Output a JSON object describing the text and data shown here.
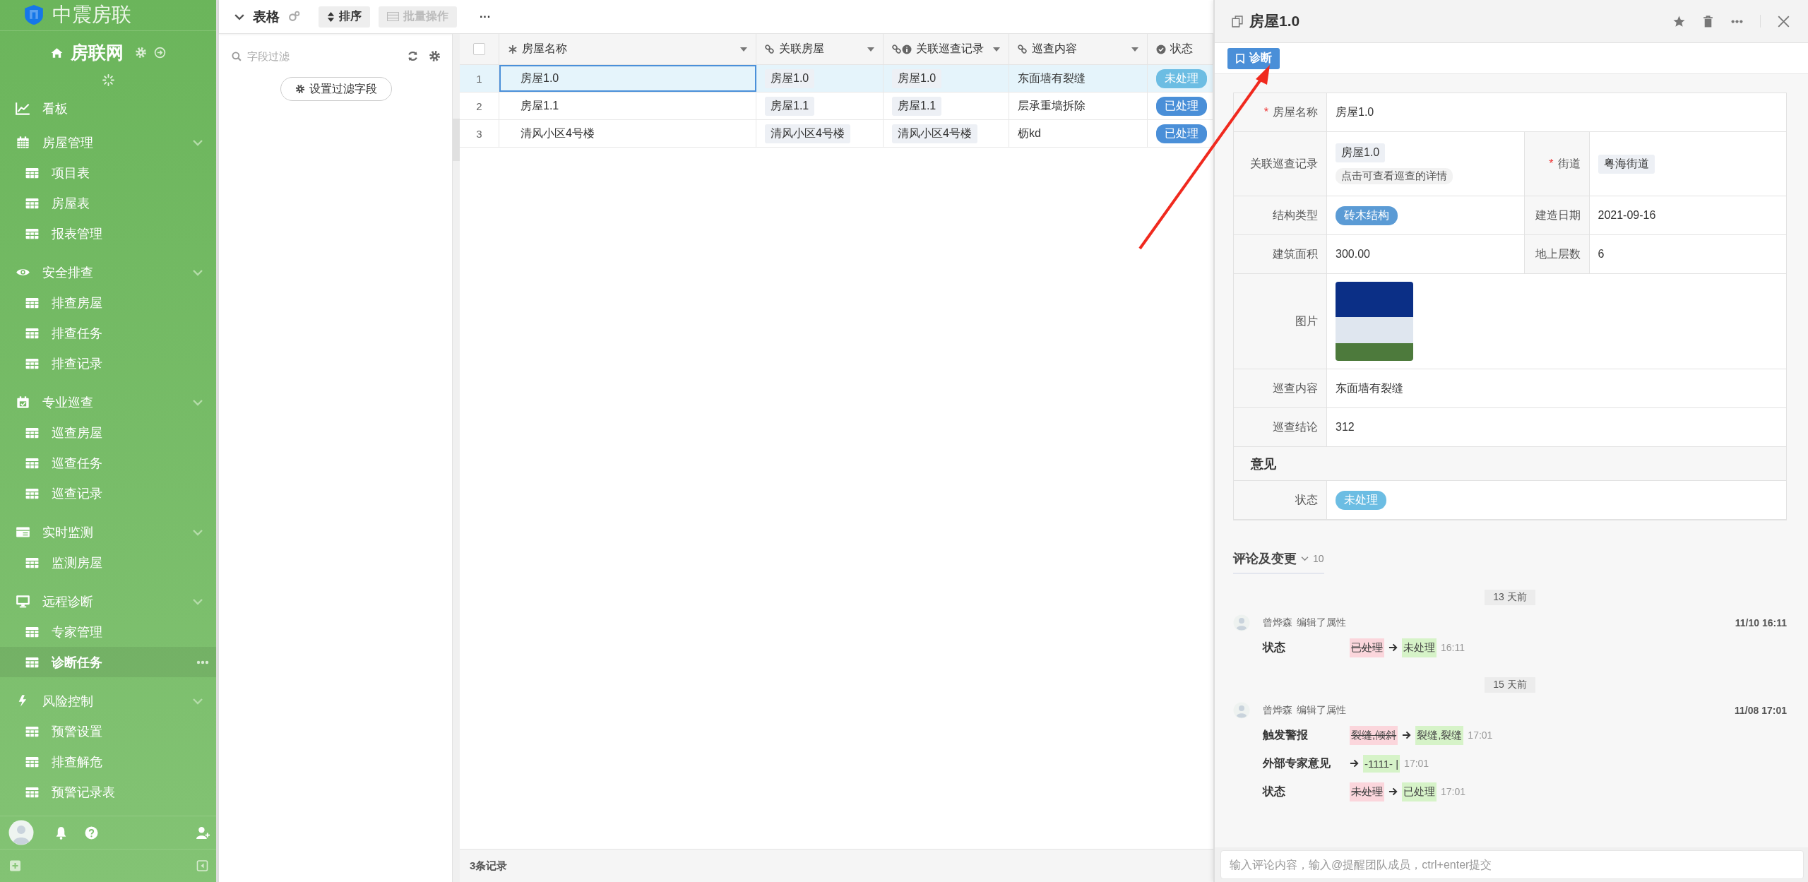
{
  "brand": "中震房联",
  "workspace": {
    "name": "房联网"
  },
  "sidebar": {
    "items": [
      {
        "kind": "link",
        "label": "看板",
        "selected": false
      },
      {
        "kind": "group",
        "label": "房屋管理",
        "expanded": true,
        "children": [
          {
            "label": "项目表",
            "selected": false
          },
          {
            "label": "房屋表",
            "selected": false
          },
          {
            "label": "报表管理",
            "selected": false
          }
        ]
      },
      {
        "kind": "group",
        "label": "安全排查",
        "expanded": true,
        "children": [
          {
            "label": "排查房屋",
            "selected": false
          },
          {
            "label": "排查任务",
            "selected": false
          },
          {
            "label": "排查记录",
            "selected": false
          }
        ]
      },
      {
        "kind": "group",
        "label": "专业巡查",
        "expanded": true,
        "children": [
          {
            "label": "巡查房屋",
            "selected": false
          },
          {
            "label": "巡查任务",
            "selected": false
          },
          {
            "label": "巡查记录",
            "selected": false
          }
        ]
      },
      {
        "kind": "group",
        "label": "实时监测",
        "expanded": true,
        "children": [
          {
            "label": "监测房屋",
            "selected": false
          }
        ]
      },
      {
        "kind": "group",
        "label": "远程诊断",
        "expanded": true,
        "children": [
          {
            "label": "专家管理",
            "selected": false
          },
          {
            "label": "诊断任务",
            "selected": true
          }
        ]
      },
      {
        "kind": "group",
        "label": "风险控制",
        "expanded": true,
        "children": [
          {
            "label": "预警设置",
            "selected": false
          },
          {
            "label": "排查解危",
            "selected": false
          },
          {
            "label": "预警记录表",
            "selected": false
          }
        ]
      }
    ]
  },
  "toolbar": {
    "view": "表格",
    "sort": "排序",
    "batch": {
      "label": "批量操作",
      "disabled": true
    },
    "more": "···"
  },
  "filter": {
    "placeholder": "字段过滤",
    "button": "设置过滤字段"
  },
  "table": {
    "all_checked": false,
    "columns": [
      {
        "label": "房屋名称",
        "menu": true
      },
      {
        "label": "关联房屋",
        "menu": true
      },
      {
        "label": "关联巡查记录",
        "menu": true
      },
      {
        "label": "巡查内容",
        "menu": true
      },
      {
        "label": "状态",
        "menu": false
      }
    ],
    "rows": [
      {
        "index": "1",
        "name": "房屋1.0",
        "house": "房屋1.0",
        "record": "房屋1.0",
        "content": "东面墙有裂缝",
        "status": {
          "label": "未处理",
          "color": "#6cbde3"
        },
        "selected": true
      },
      {
        "index": "2",
        "name": "房屋1.1",
        "house": "房屋1.1",
        "record": "房屋1.1",
        "content": "层承重墙拆除",
        "status": {
          "label": "已处理",
          "color": "#4a8fd8"
        },
        "selected": false
      },
      {
        "index": "3",
        "name": "清风小区4号楼",
        "house": "清风小区4号楼",
        "record": "清风小区4号楼",
        "content": "枥kd",
        "status": {
          "label": "已处理",
          "color": "#4a8fd8"
        },
        "selected": false
      }
    ],
    "footer": "3条记录"
  },
  "detail": {
    "title": "房屋1.0",
    "action": "诊断",
    "rows": [
      {
        "kind": "fields",
        "cells": [
          {
            "kind": "text",
            "label": "房屋名称",
            "required_mark": "*",
            "value": "房屋1.0"
          }
        ]
      },
      {
        "kind": "fields",
        "cells": [
          {
            "kind": "link",
            "label": "关联巡查记录",
            "tags": [
              "房屋1.0"
            ],
            "hint": "点击可查看巡查的详情"
          },
          {
            "kind": "tag",
            "label": "街道",
            "required_mark": "*",
            "value": "粤海街道"
          }
        ]
      },
      {
        "kind": "fields",
        "cells": [
          {
            "kind": "pill",
            "label": "结构类型",
            "value": "砖木结构"
          },
          {
            "kind": "text",
            "label": "建造日期",
            "value": "2021-09-16"
          }
        ]
      },
      {
        "kind": "fields",
        "cells": [
          {
            "kind": "text",
            "label": "建筑面积",
            "value": "300.00"
          },
          {
            "kind": "text",
            "label": "地上层数",
            "value": "6"
          }
        ]
      },
      {
        "kind": "fields",
        "cells": [
          {
            "kind": "image",
            "label": "图片"
          }
        ]
      },
      {
        "kind": "fields",
        "cells": [
          {
            "kind": "text",
            "label": "巡查内容",
            "value": "东面墙有裂缝"
          }
        ]
      },
      {
        "kind": "fields",
        "cells": [
          {
            "kind": "text",
            "label": "巡查结论",
            "value": "312"
          }
        ]
      },
      {
        "kind": "section",
        "title": "意见"
      },
      {
        "kind": "fields",
        "cells": [
          {
            "kind": "status",
            "label": "状态",
            "value": "未处理",
            "color": "#6cbde3"
          }
        ]
      }
    ]
  },
  "activity": {
    "title": "评论及变更",
    "count": "10",
    "groups": [
      {
        "when": "13 天前",
        "entries": [
          {
            "author": "曾烨森",
            "action": "编辑了属性",
            "time": "11/10 16:11",
            "changes": [
              {
                "field": "状态",
                "old": "已处理",
                "new": "未处理",
                "time": "16:11"
              }
            ]
          }
        ]
      },
      {
        "when": "15 天前",
        "entries": [
          {
            "author": "曾烨森",
            "action": "编辑了属性",
            "time": "11/08 17:01",
            "changes": [
              {
                "field": "触发警报",
                "old": "裂缝,倾斜",
                "new": "裂缝,裂缝",
                "time": "17:01"
              },
              {
                "field": "外部专家意见",
                "new": "-1111- |",
                "time": "17:01"
              },
              {
                "field": "状态",
                "old": "未处理",
                "new": "已处理",
                "time": "17:01"
              }
            ]
          }
        ]
      }
    ],
    "placeholder": "输入评论内容，输入@提醒团队成员，ctrl+enter提交"
  }
}
